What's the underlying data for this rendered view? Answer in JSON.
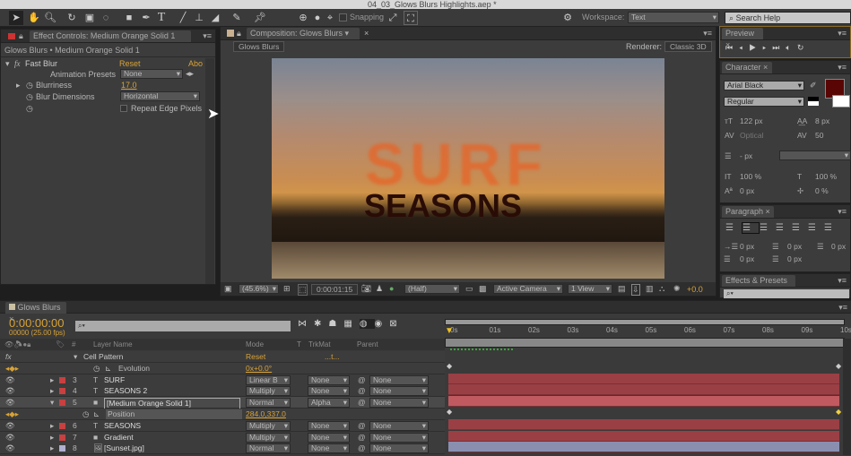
{
  "window": {
    "title": "04_03_Glows Blurs Highlights.aep *"
  },
  "toolbar": {
    "snapping_label": "Snapping",
    "workspace_label": "Workspace:",
    "workspace_value": "Text",
    "search_placeholder": "Search Help"
  },
  "effect_controls": {
    "tab": "Effect Controls: Medium Orange Solid 1",
    "breadcrumb": "Glows Blurs • Medium Orange Solid 1",
    "effect_name": "Fast Blur",
    "reset": "Reset",
    "about": "Abo",
    "animation_presets_label": "Animation Presets",
    "animation_presets_value": "None",
    "blurriness_label": "Blurriness",
    "blurriness_value": "17.0",
    "blur_dimensions_label": "Blur Dimensions",
    "blur_dimensions_value": "Horizontal",
    "repeat_edge_label": "Repeat Edge Pixels"
  },
  "composition": {
    "tab": "Composition: Glows Blurs",
    "sub_tab": "Glows Blurs",
    "renderer_label": "Renderer:",
    "renderer_value": "Classic 3D",
    "text_line1": "SURF",
    "text_line2": "SEASONS",
    "zoom": "(45.6%)",
    "timecode": "0:00:01:15",
    "resolution": "(Half)",
    "camera": "Active Camera",
    "views": "1 View",
    "exposure": "+0.0"
  },
  "preview": {
    "tab": "Preview"
  },
  "character": {
    "tab": "Character",
    "font": "Arial Black",
    "style": "Regular",
    "fill_color": "#5a0505",
    "size": "122 px",
    "leading": "8 px",
    "kerning": "Optical",
    "tracking": "50",
    "line_spacing": "- px",
    "vscale": "100 %",
    "hscale": "100 %",
    "baseline": "0 px",
    "tsume": "0 %"
  },
  "paragraph": {
    "tab": "Paragraph",
    "indents": [
      "0 px",
      "0 px",
      "0 px",
      "0 px",
      "0 px"
    ]
  },
  "effects_presets": {
    "tab": "Effects & Presets"
  },
  "timeline": {
    "tab": "Glows Blurs",
    "timecode": "0:00:00:00",
    "frame_info": "00000 (25.00 fps)",
    "columns": {
      "layer_name": "Layer Name",
      "mode": "Mode",
      "t": "T",
      "trkmat": "TrkMat",
      "parent": "Parent",
      "num": "#"
    },
    "ruler": [
      "0s",
      "01s",
      "02s",
      "03s",
      "04s",
      "05s",
      "06s",
      "07s",
      "08s",
      "09s",
      "10s"
    ],
    "rows": [
      {
        "type": "effect",
        "name": "Cell Pattern",
        "value": "Reset",
        "extra": "...t..."
      },
      {
        "type": "prop",
        "name": "Evolution",
        "value": "0x+0.0°"
      },
      {
        "type": "layer",
        "num": "3",
        "name": "SURF",
        "mode": "Linear B",
        "trkmat": "None",
        "parent": "None",
        "color": "#c84040",
        "icon": "T",
        "bar": "#9a4045"
      },
      {
        "type": "layer",
        "num": "4",
        "name": "SEASONS 2",
        "mode": "Multiply",
        "trkmat": "None",
        "parent": "None",
        "color": "#c84040",
        "icon": "T",
        "bar": "#9a4045"
      },
      {
        "type": "layer",
        "num": "5",
        "name": "[Medium Orange Solid 1]",
        "mode": "Normal",
        "trkmat": "Alpha",
        "parent": "None",
        "color": "#c84040",
        "icon": "solid",
        "bar": "#c05a60",
        "selected": true
      },
      {
        "type": "prop",
        "name": "Position",
        "value": "284.0,337.0"
      },
      {
        "type": "layer",
        "num": "6",
        "name": "SEASONS",
        "mode": "Multiply",
        "trkmat": "None",
        "parent": "None",
        "color": "#c84040",
        "icon": "T",
        "bar": "#9a4045"
      },
      {
        "type": "layer",
        "num": "7",
        "name": "Gradient",
        "mode": "Multiply",
        "trkmat": "None",
        "parent": "None",
        "color": "#c84040",
        "icon": "solid",
        "bar": "#9a4045"
      },
      {
        "type": "layer",
        "num": "8",
        "name": "[Sunset.jpg]",
        "mode": "Normal",
        "trkmat": "None",
        "parent": "None",
        "color": "#b0b0d0",
        "icon": "image",
        "bar": "#8a8fb0"
      }
    ]
  }
}
